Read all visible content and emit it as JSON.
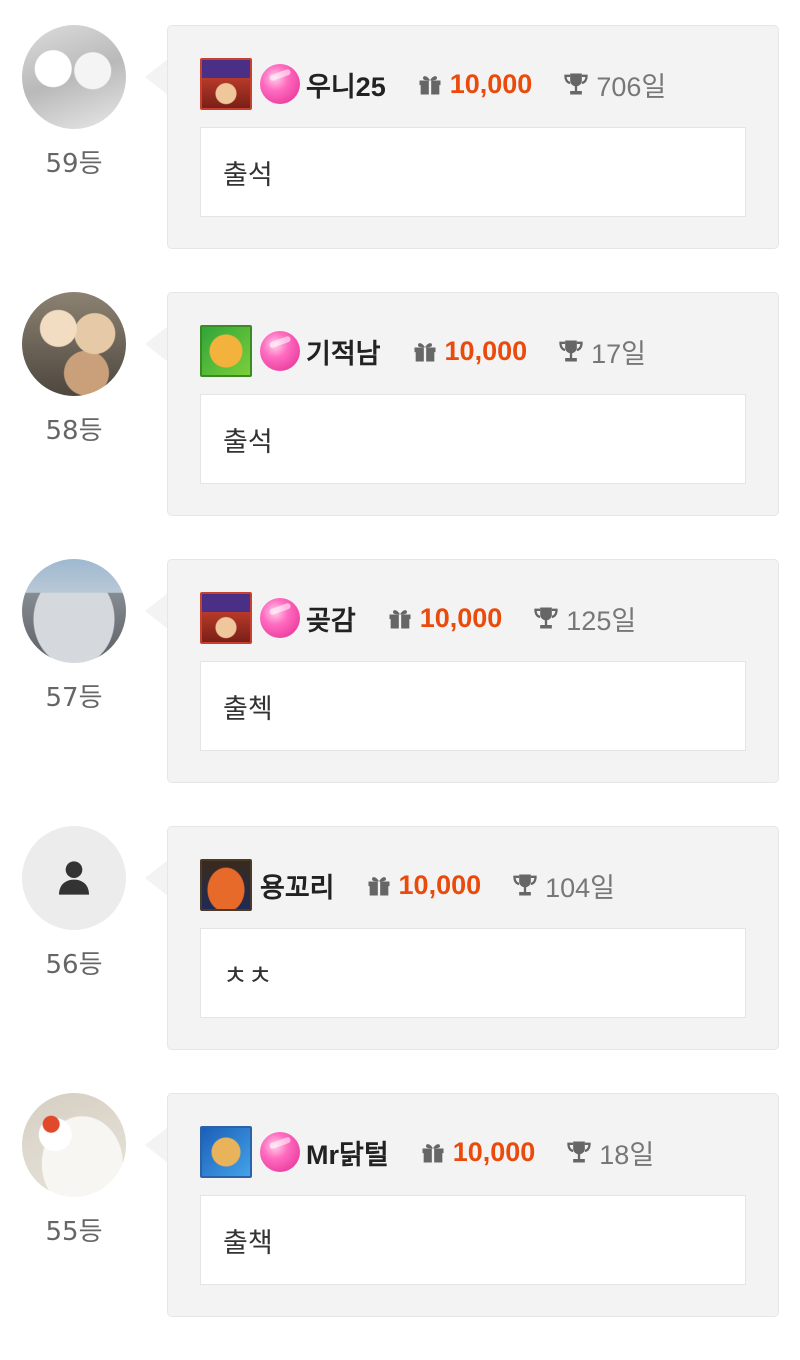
{
  "colors": {
    "points": "#ea4b0c",
    "bubble_bg": "#f3f3f3",
    "candy": "#e2288f"
  },
  "entries": [
    {
      "rank": "59등",
      "nickname": "우니25",
      "has_candy": true,
      "badge": "wizard-badge",
      "points": "10,000",
      "days": "706일",
      "comment": "출석",
      "avatar": "dogs-photo"
    },
    {
      "rank": "58등",
      "nickname": "기적남",
      "has_candy": true,
      "badge": "frog-badge",
      "points": "10,000",
      "days": "17일",
      "comment": "출석",
      "avatar": "cartoon-photo"
    },
    {
      "rank": "57등",
      "nickname": "곶감",
      "has_candy": true,
      "badge": "wizard-badge",
      "points": "10,000",
      "days": "125일",
      "comment": "출첵",
      "avatar": "car-photo"
    },
    {
      "rank": "56등",
      "nickname": "용꼬리",
      "has_candy": false,
      "badge": "monster-badge",
      "points": "10,000",
      "days": "104일",
      "comment": "ㅊㅊ",
      "avatar": "default-user-icon"
    },
    {
      "rank": "55등",
      "nickname": "Mr닭털",
      "has_candy": true,
      "badge": "blue-badge",
      "points": "10,000",
      "days": "18일",
      "comment": "출책",
      "avatar": "hen-photo"
    }
  ]
}
